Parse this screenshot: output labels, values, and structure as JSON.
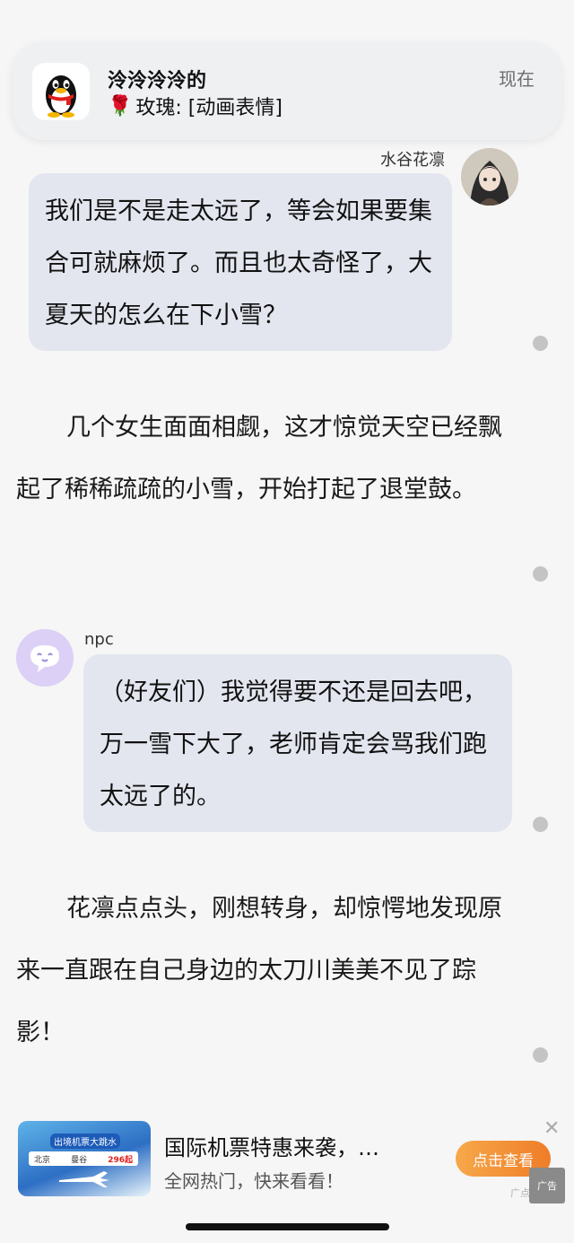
{
  "notification": {
    "app_icon": "qq-penguin-icon",
    "sender": "泠泠泠泠的",
    "emoji": "🌹",
    "message": "玫瑰: [动画表情]",
    "time": "现在"
  },
  "chat": [
    {
      "speaker": "水谷花凛",
      "avatar": "anime-girl-avatar",
      "text": "我们是不是走太远了，等会如果要集合可就麻烦了。而且也太奇怪了，大夏天的怎么在下小雪？"
    },
    {
      "narration": "几个女生面面相觑，这才惊觉天空已经飘起了稀稀疏疏的小雪，开始打起了退堂鼓。"
    },
    {
      "speaker": "npc",
      "avatar": "chat-bubble-avatar",
      "text": "（好友们）我觉得要不还是回去吧，万一雪下大了，老师肯定会骂我们跑太远了的。"
    },
    {
      "narration": "花凛点点头，刚想转身，却惊愕地发现原来一直跟在自己身边的太刀川美美不见了踪影！"
    }
  ],
  "ad": {
    "title": "国际机票特惠来袭，…",
    "subtitle": "全网热门，快来看看！",
    "button": "点击查看",
    "label": "广点",
    "logo_text": "广告",
    "thumb_banner": "出境机票大跳水",
    "thumb_route_from": "北京",
    "thumb_route_to": "曼谷",
    "thumb_price": "296起"
  },
  "colors": {
    "bubble": "#e3e6ef",
    "background": "#f6f6f6",
    "ad_button": "#ef7d28",
    "npc_avatar": "#d9cdf6"
  }
}
